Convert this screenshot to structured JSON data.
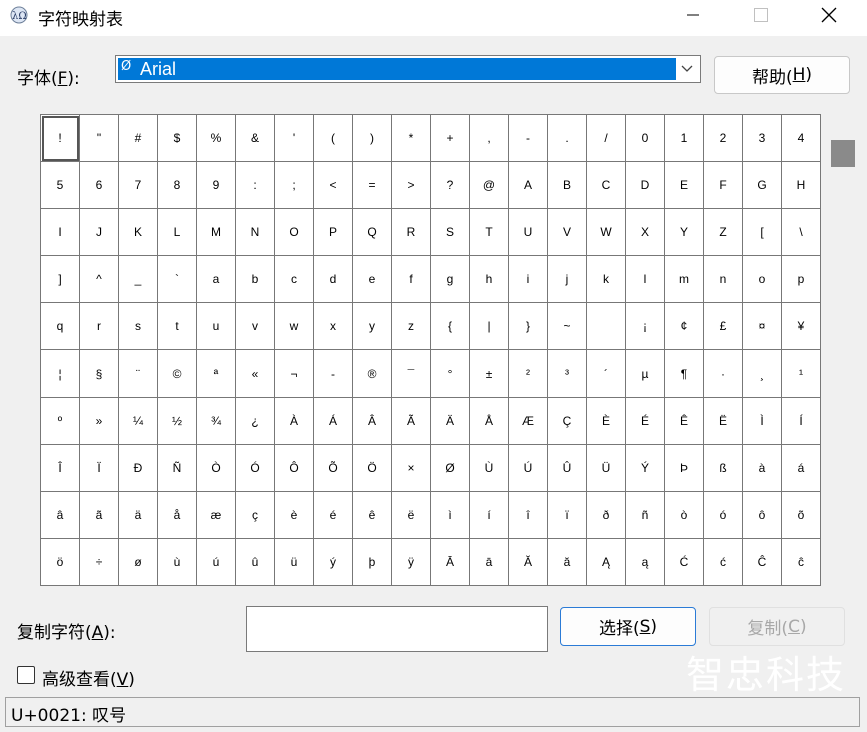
{
  "window": {
    "title": "字符映射表",
    "icon": "charmap-app-icon",
    "controls": [
      "minimize-icon",
      "maximize-icon",
      "close-icon"
    ]
  },
  "font": {
    "label_prefix": "字体(",
    "label_key": "F",
    "label_suffix": "):",
    "selected": "Arial",
    "dropdown_icon": "chevron-down-icon"
  },
  "help_button": {
    "prefix": "帮助(",
    "key": "H",
    "suffix": ")"
  },
  "characters": [
    "!",
    "\"",
    "#",
    "$",
    "%",
    "&",
    "'",
    "(",
    ")",
    "*",
    "+",
    ",",
    "-",
    ".",
    "/",
    "0",
    "1",
    "2",
    "3",
    "4",
    "5",
    "6",
    "7",
    "8",
    "9",
    ":",
    ";",
    "<",
    "=",
    ">",
    "?",
    "@",
    "A",
    "B",
    "C",
    "D",
    "E",
    "F",
    "G",
    "H",
    "I",
    "J",
    "K",
    "L",
    "M",
    "N",
    "O",
    "P",
    "Q",
    "R",
    "S",
    "T",
    "U",
    "V",
    "W",
    "X",
    "Y",
    "Z",
    "[",
    "\\",
    "]",
    "^",
    "_",
    "`",
    "a",
    "b",
    "c",
    "d",
    "e",
    "f",
    "g",
    "h",
    "i",
    "j",
    "k",
    "l",
    "m",
    "n",
    "o",
    "p",
    "q",
    "r",
    "s",
    "t",
    "u",
    "v",
    "w",
    "x",
    "y",
    "z",
    "{",
    "|",
    "}",
    "~",
    " ",
    "¡",
    "¢",
    "£",
    "¤",
    "¥",
    "¦",
    "§",
    "¨",
    "©",
    "ª",
    "«",
    "¬",
    "-",
    "®",
    "¯",
    "°",
    "±",
    "²",
    "³",
    "´",
    "µ",
    "¶",
    "·",
    "¸",
    "¹",
    "º",
    "»",
    "¼",
    "½",
    "¾",
    "¿",
    "À",
    "Á",
    "Â",
    "Ã",
    "Ä",
    "Å",
    "Æ",
    "Ç",
    "È",
    "É",
    "Ê",
    "Ë",
    "Ì",
    "Í",
    "Î",
    "Ï",
    "Ð",
    "Ñ",
    "Ò",
    "Ó",
    "Ô",
    "Õ",
    "Ö",
    "×",
    "Ø",
    "Ù",
    "Ú",
    "Û",
    "Ü",
    "Ý",
    "Þ",
    "ß",
    "à",
    "á",
    "â",
    "ã",
    "ä",
    "å",
    "æ",
    "ç",
    "è",
    "é",
    "ê",
    "ë",
    "ì",
    "í",
    "î",
    "ï",
    "ð",
    "ñ",
    "ò",
    "ó",
    "ô",
    "õ",
    "ö",
    "÷",
    "ø",
    "ù",
    "ú",
    "û",
    "ü",
    "ý",
    "þ",
    "ÿ",
    "Ā",
    "ā",
    "Ă",
    "ă",
    "Ą",
    "ą",
    "Ć",
    "ć",
    "Ĉ",
    "ĉ"
  ],
  "selected_index": 0,
  "copy": {
    "label_prefix": "复制字符(",
    "label_key": "A",
    "label_suffix": "):",
    "value": "",
    "select_button": {
      "prefix": "选择(",
      "key": "S",
      "suffix": ")"
    },
    "copy_button": {
      "prefix": "复制(",
      "key": "C",
      "suffix": ")"
    }
  },
  "advanced": {
    "prefix": "高级查看(",
    "key": "V",
    "suffix": ")",
    "checked": false
  },
  "watermark": "智忠科技",
  "status": "U+0021: 叹号",
  "colors": {
    "selection": "#0078d7",
    "select_button_border": "#2b7bd6",
    "scrollbar_thumb": "#8a8a8a"
  }
}
